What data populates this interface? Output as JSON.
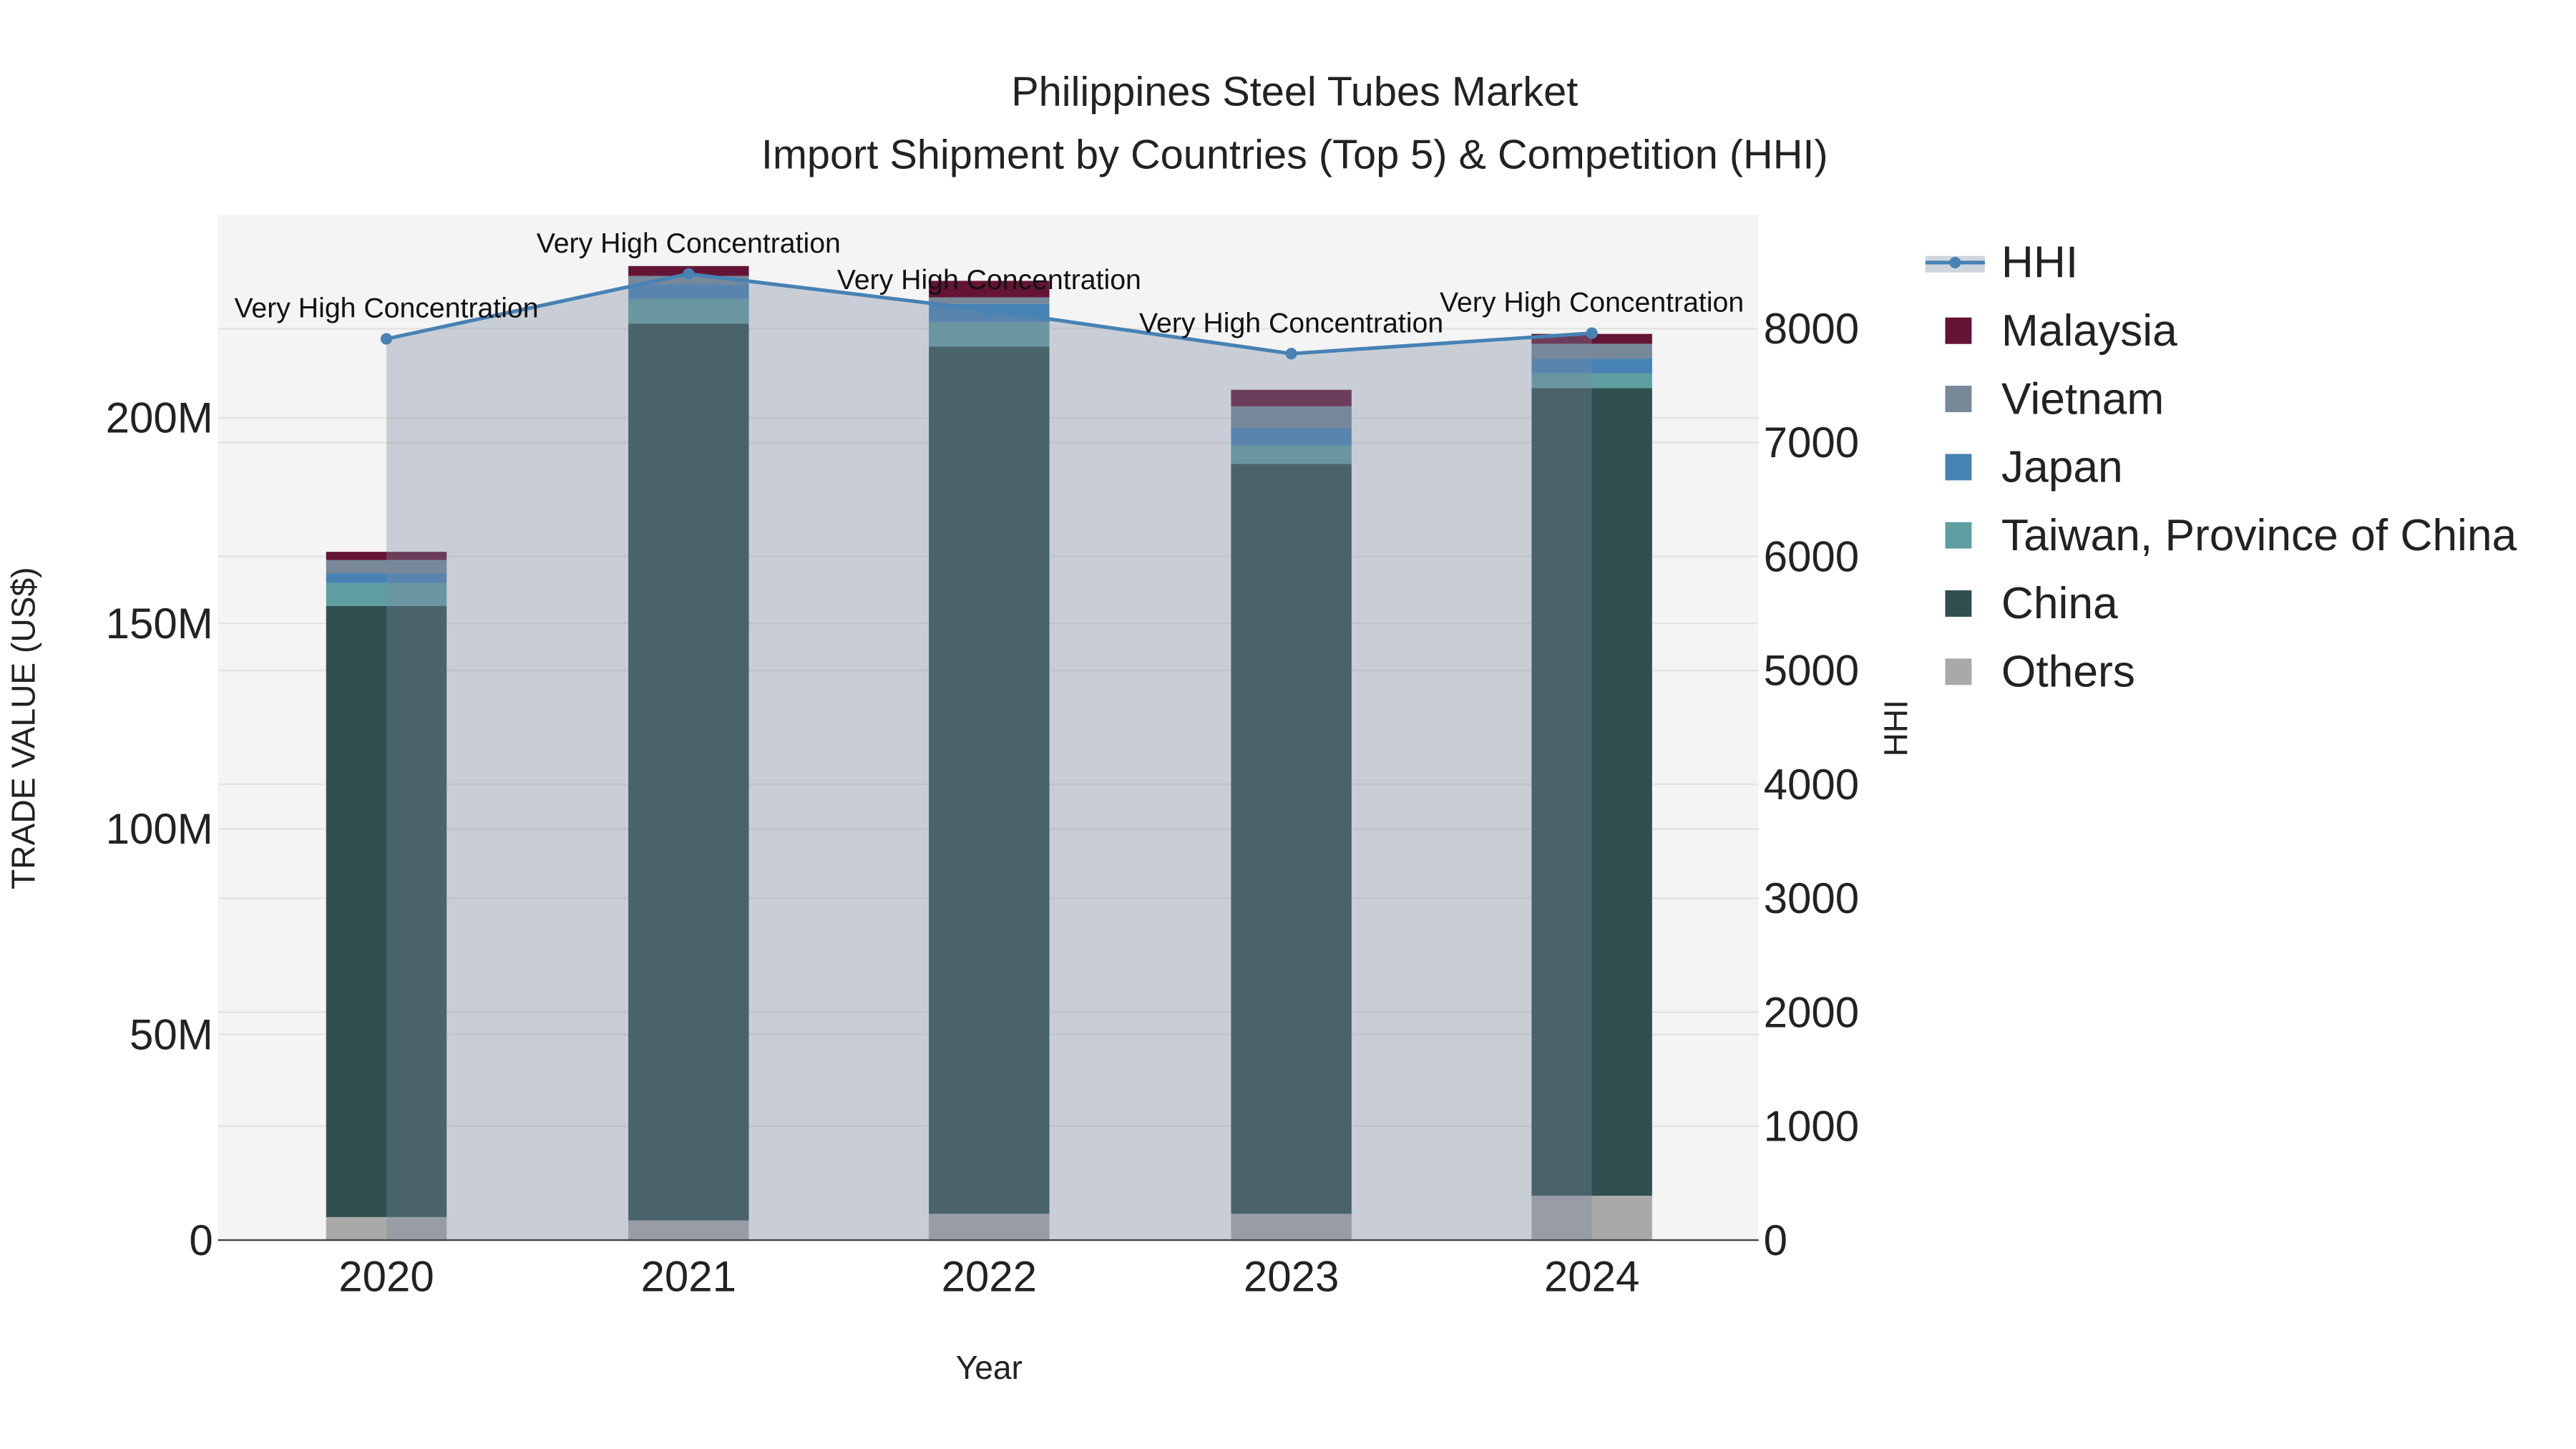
{
  "chart_data": {
    "type": "bar",
    "title": "Philippines Steel Tubes Market",
    "subtitle": "Import Shipment by Countries (Top 5) & Competition (HHI)",
    "xlabel": "Year",
    "ylabel": "TRADE VALUE (US$)",
    "y2label": "HHI",
    "categories": [
      "2020",
      "2021",
      "2022",
      "2023",
      "2024"
    ],
    "ylim": [
      0,
      250
    ],
    "y_unit": "M US$",
    "y_ticks": [
      0,
      50,
      100,
      150,
      200
    ],
    "y_tick_labels": [
      "0",
      "50M",
      "100M",
      "150M",
      "200M"
    ],
    "y2lim": [
      0,
      9000
    ],
    "y2_ticks": [
      0,
      1000,
      2000,
      3000,
      4000,
      5000,
      6000,
      7000,
      8000
    ],
    "y2_tick_labels": [
      "0",
      "1000",
      "2000",
      "3000",
      "4000",
      "5000",
      "6000",
      "7000",
      "8000"
    ],
    "grid": true,
    "legend_position": "right",
    "stack_order": [
      "Others",
      "China",
      "Taiwan, Province of China",
      "Japan",
      "Vietnam",
      "Malaysia"
    ],
    "series": [
      {
        "name": "Others",
        "color": "#a9a9a9",
        "values": [
          5.6,
          4.8,
          6.4,
          6.4,
          10.8
        ]
      },
      {
        "name": "China",
        "color": "#2f4f4f",
        "values": [
          148.6,
          218.1,
          210.9,
          182.4,
          196.4
        ]
      },
      {
        "name": "Taiwan, Province of China",
        "color": "#5f9ea0",
        "values": [
          5.6,
          6.0,
          6.0,
          4.4,
          3.6
        ]
      },
      {
        "name": "Japan",
        "color": "#4682b4",
        "values": [
          2.4,
          3.6,
          4.4,
          4.4,
          3.6
        ]
      },
      {
        "name": "Vietnam",
        "color": "#778899",
        "values": [
          3.2,
          2.0,
          1.6,
          5.2,
          3.6
        ]
      },
      {
        "name": "Malaysia",
        "color": "#641434",
        "values": [
          2.0,
          2.4,
          4.0,
          4.0,
          2.4
        ]
      }
    ],
    "hhi": {
      "name": "HHI",
      "color": "#4682b4",
      "values": [
        7910,
        8480,
        8160,
        7780,
        7960
      ],
      "annotations": [
        "Very High Concentration",
        "Very High Concentration",
        "Very High Concentration",
        "Very High Concentration",
        "Very High Concentration"
      ]
    },
    "legend": [
      "HHI",
      "Malaysia",
      "Vietnam",
      "Japan",
      "Taiwan, Province of China",
      "China",
      "Others"
    ]
  }
}
